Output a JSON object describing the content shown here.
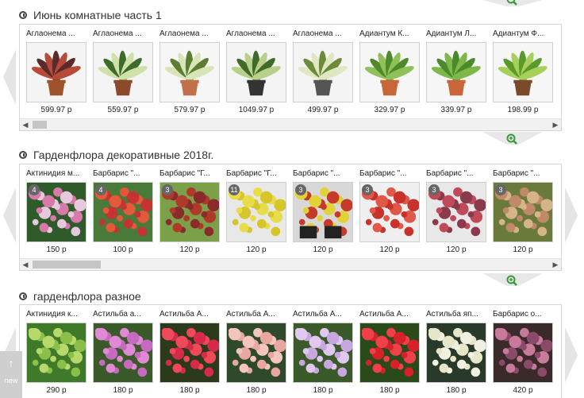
{
  "sections": [
    {
      "title": "Июнь комнатные часть 1",
      "items": [
        {
          "name": "Аглаонема ...",
          "price": "599.97 р",
          "badge": ""
        },
        {
          "name": "Аглаонема ...",
          "price": "559.97 р",
          "badge": ""
        },
        {
          "name": "Аглаонема ...",
          "price": "579.97 р",
          "badge": ""
        },
        {
          "name": "Аглаонема ...",
          "price": "1049.97 р",
          "badge": ""
        },
        {
          "name": "Аглаонема ...",
          "price": "499.97 р",
          "badge": ""
        },
        {
          "name": "Адиантум К...",
          "price": "329.97 р",
          "badge": ""
        },
        {
          "name": "Адиантум Л...",
          "price": "339.97 р",
          "badge": ""
        },
        {
          "name": "Адиантум Ф...",
          "price": "198.99 р",
          "badge": ""
        }
      ]
    },
    {
      "title": "Гарденфлора декоративные 2018г.",
      "items": [
        {
          "name": "Актинидия м...",
          "price": "150 р",
          "badge": "4"
        },
        {
          "name": "Барбарис \"...",
          "price": "100 р",
          "badge": "4"
        },
        {
          "name": "Барбарис \"Г...",
          "price": "120 р",
          "badge": "3"
        },
        {
          "name": "Барбарис \"Г...",
          "price": "120 р",
          "badge": "11"
        },
        {
          "name": "Барбарис \"...",
          "price": "120 р",
          "badge": "3"
        },
        {
          "name": "Барбарис \"...",
          "price": "120 р",
          "badge": "3"
        },
        {
          "name": "Барбарис \"...",
          "price": "120 р",
          "badge": "3"
        },
        {
          "name": "Барбарис \"...",
          "price": "120 р",
          "badge": "3"
        }
      ]
    },
    {
      "title": "гарденфлора разное",
      "items": [
        {
          "name": "Актинидия к...",
          "price": "290 р",
          "badge": ""
        },
        {
          "name": "Астильба а...",
          "price": "180 р",
          "badge": ""
        },
        {
          "name": "Астильба А...",
          "price": "180 р",
          "badge": ""
        },
        {
          "name": "Астильба А...",
          "price": "180 р",
          "badge": ""
        },
        {
          "name": "Астильба А...",
          "price": "180 р",
          "badge": ""
        },
        {
          "name": "Астильба А...",
          "price": "180 р",
          "badge": ""
        },
        {
          "name": "Астильба яп...",
          "price": "180 р",
          "badge": ""
        },
        {
          "name": "Барбарис о...",
          "price": "420 р",
          "badge": ""
        }
      ]
    }
  ],
  "scroll_up": {
    "arrow": "↑",
    "label": "new"
  },
  "scroll_arrows": {
    "left": "◀",
    "right": "▶"
  },
  "icons": {
    "section": "clock-icon",
    "zoom": "zoom-in-icon",
    "scroll_up": "arrow-up-icon"
  },
  "colors": {
    "accent_green": "#3a9a3a",
    "border": "#d6d6d6"
  }
}
